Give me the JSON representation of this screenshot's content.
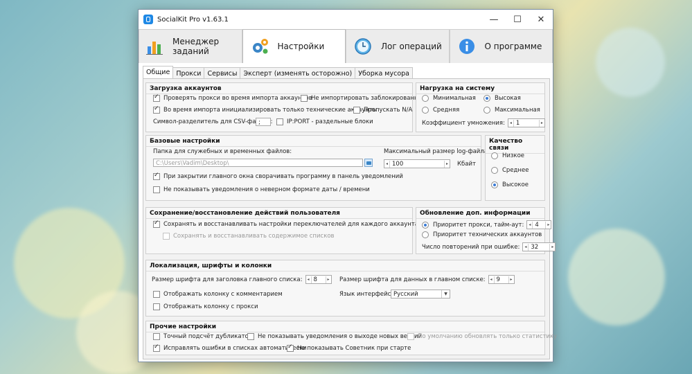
{
  "window": {
    "title": "SocialKit Pro v1.63.1",
    "min": "—",
    "max": "☐",
    "close": "✕"
  },
  "main_tabs": [
    {
      "label": "Менеджер заданий",
      "icon": "bar-chart-icon"
    },
    {
      "label": "Настройки",
      "icon": "gears-icon"
    },
    {
      "label": "Лог операций",
      "icon": "clock-icon"
    },
    {
      "label": "О программе",
      "icon": "info-icon"
    }
  ],
  "sub_tabs": [
    "Общие",
    "Прокси",
    "Сервисы",
    "Эксперт (изменять осторожно)",
    "Уборка мусора"
  ],
  "accounts": {
    "header": "Загрузка аккаунтов",
    "check_proxy": "Проверять прокси во время импорта аккаунтов",
    "no_import_blocked": "Не импортировать заблокированные",
    "init_tech": "Во время импорта инициализировать только технические аккаунты",
    "skip_na": "Пропускать N/A",
    "csv_sep_label": "Символ-разделитель для CSV-файлов:",
    "csv_sep_value": ";",
    "ipport": "IP:PORT - раздельные блоки"
  },
  "load": {
    "header": "Нагрузка на систему",
    "min": "Минимальная",
    "high": "Высокая",
    "mid": "Средняя",
    "max": "Максимальная",
    "coef_label": "Коэффициент умножения:",
    "coef_value": "1"
  },
  "basic": {
    "header": "Базовые настройки",
    "folder_label": "Папка для служебных и временных файлов:",
    "folder_value": "C:\\Users\\Vadim\\Desktop\\",
    "log_label": "Максимальный размер log-файла:",
    "log_value": "100",
    "log_unit": "Кбайт",
    "minimize_tray": "При закрытии главного окна сворачивать программу в панель уведомлений",
    "no_date_warn": "Не показывать уведомления о неверном формате даты / времени"
  },
  "quality": {
    "header": "Качество связи",
    "low": "Низкое",
    "mid": "Среднее",
    "high": "Высокое"
  },
  "save": {
    "header": "Сохранение/восстановление действий пользователя",
    "save_switches": "Сохранять и восстанавливать настройки переключателей для каждого аккаунта",
    "save_lists": "Сохранять и восстанавливать содержимое списков"
  },
  "update": {
    "header": "Обновление доп. информации",
    "prio_proxy": "Приоритет прокси, тайм-аут:",
    "timeout": "4",
    "prio_tech": "Приоритет технических аккаунтов",
    "retries_label": "Число повторений при ошибке:",
    "retries": "32"
  },
  "locale": {
    "header": "Локализация, шрифты и колонки",
    "header_font_label": "Размер шрифта для заголовка главного списка:",
    "header_font": "8",
    "data_font_label": "Размер шрифта для данных в главном списке:",
    "data_font": "9",
    "show_comment": "Отображать колонку с комментарием",
    "show_proxy": "Отображать колонку с прокси",
    "lang_label": "Язык интерфейса:",
    "lang_value": "Русский"
  },
  "other": {
    "header": "Прочие настройки",
    "exact_dupes": "Точный подсчёт дубликатов",
    "no_new_version": "Не показывать уведомления о выходе новых версий",
    "stats_only": "По умолчанию обновлять только статистику",
    "auto_fix": "Исправлять ошибки в списках автоматически",
    "no_advisor": "Не показывать Советник при старте"
  }
}
